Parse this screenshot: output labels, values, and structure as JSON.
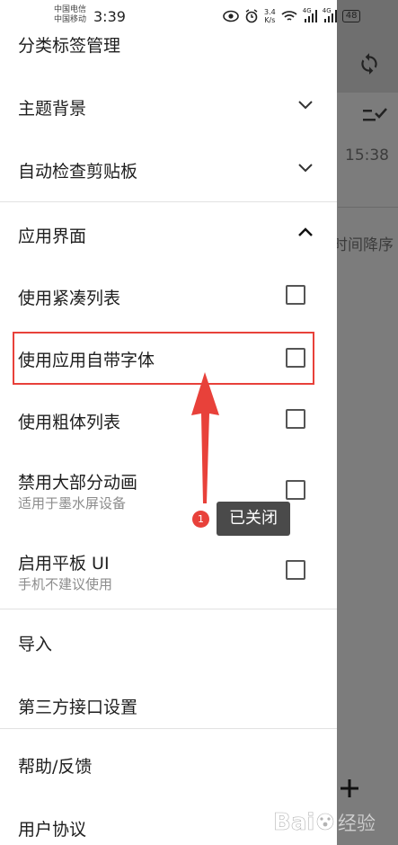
{
  "status_bar": {
    "carrier_line1": "中国电信",
    "carrier_line2": "中国移动",
    "time": "3:39",
    "net_speed_value": "3.4",
    "net_speed_unit": "K/s",
    "signal1_label": "4G",
    "signal2_label": "4G",
    "battery": "48"
  },
  "background": {
    "timestamp": "15:38",
    "sort_label": "时间降序"
  },
  "drawer": {
    "items": [
      {
        "label": "分类标签管理"
      },
      {
        "label": "主题背景"
      },
      {
        "label": "自动检查剪贴板"
      },
      {
        "label": "应用界面"
      },
      {
        "label": "使用紧凑列表"
      },
      {
        "label": "使用应用自带字体"
      },
      {
        "label": "使用粗体列表"
      },
      {
        "label": "禁用大部分动画",
        "sub": "适用于墨水屏设备"
      },
      {
        "label": "启用平板 UI",
        "sub": "手机不建议使用"
      },
      {
        "label": "导入"
      },
      {
        "label": "第三方接口设置"
      },
      {
        "label": "帮助/反馈"
      },
      {
        "label": "用户协议"
      }
    ]
  },
  "annotation": {
    "badge_number": "1",
    "tooltip_text": "已关闭"
  },
  "watermark": {
    "text": "Bai",
    "suffix": "经验"
  },
  "colors": {
    "annotation_red": "#e8413a",
    "drawer_bg": "#ffffff",
    "scrim": "#7b7b7b"
  }
}
